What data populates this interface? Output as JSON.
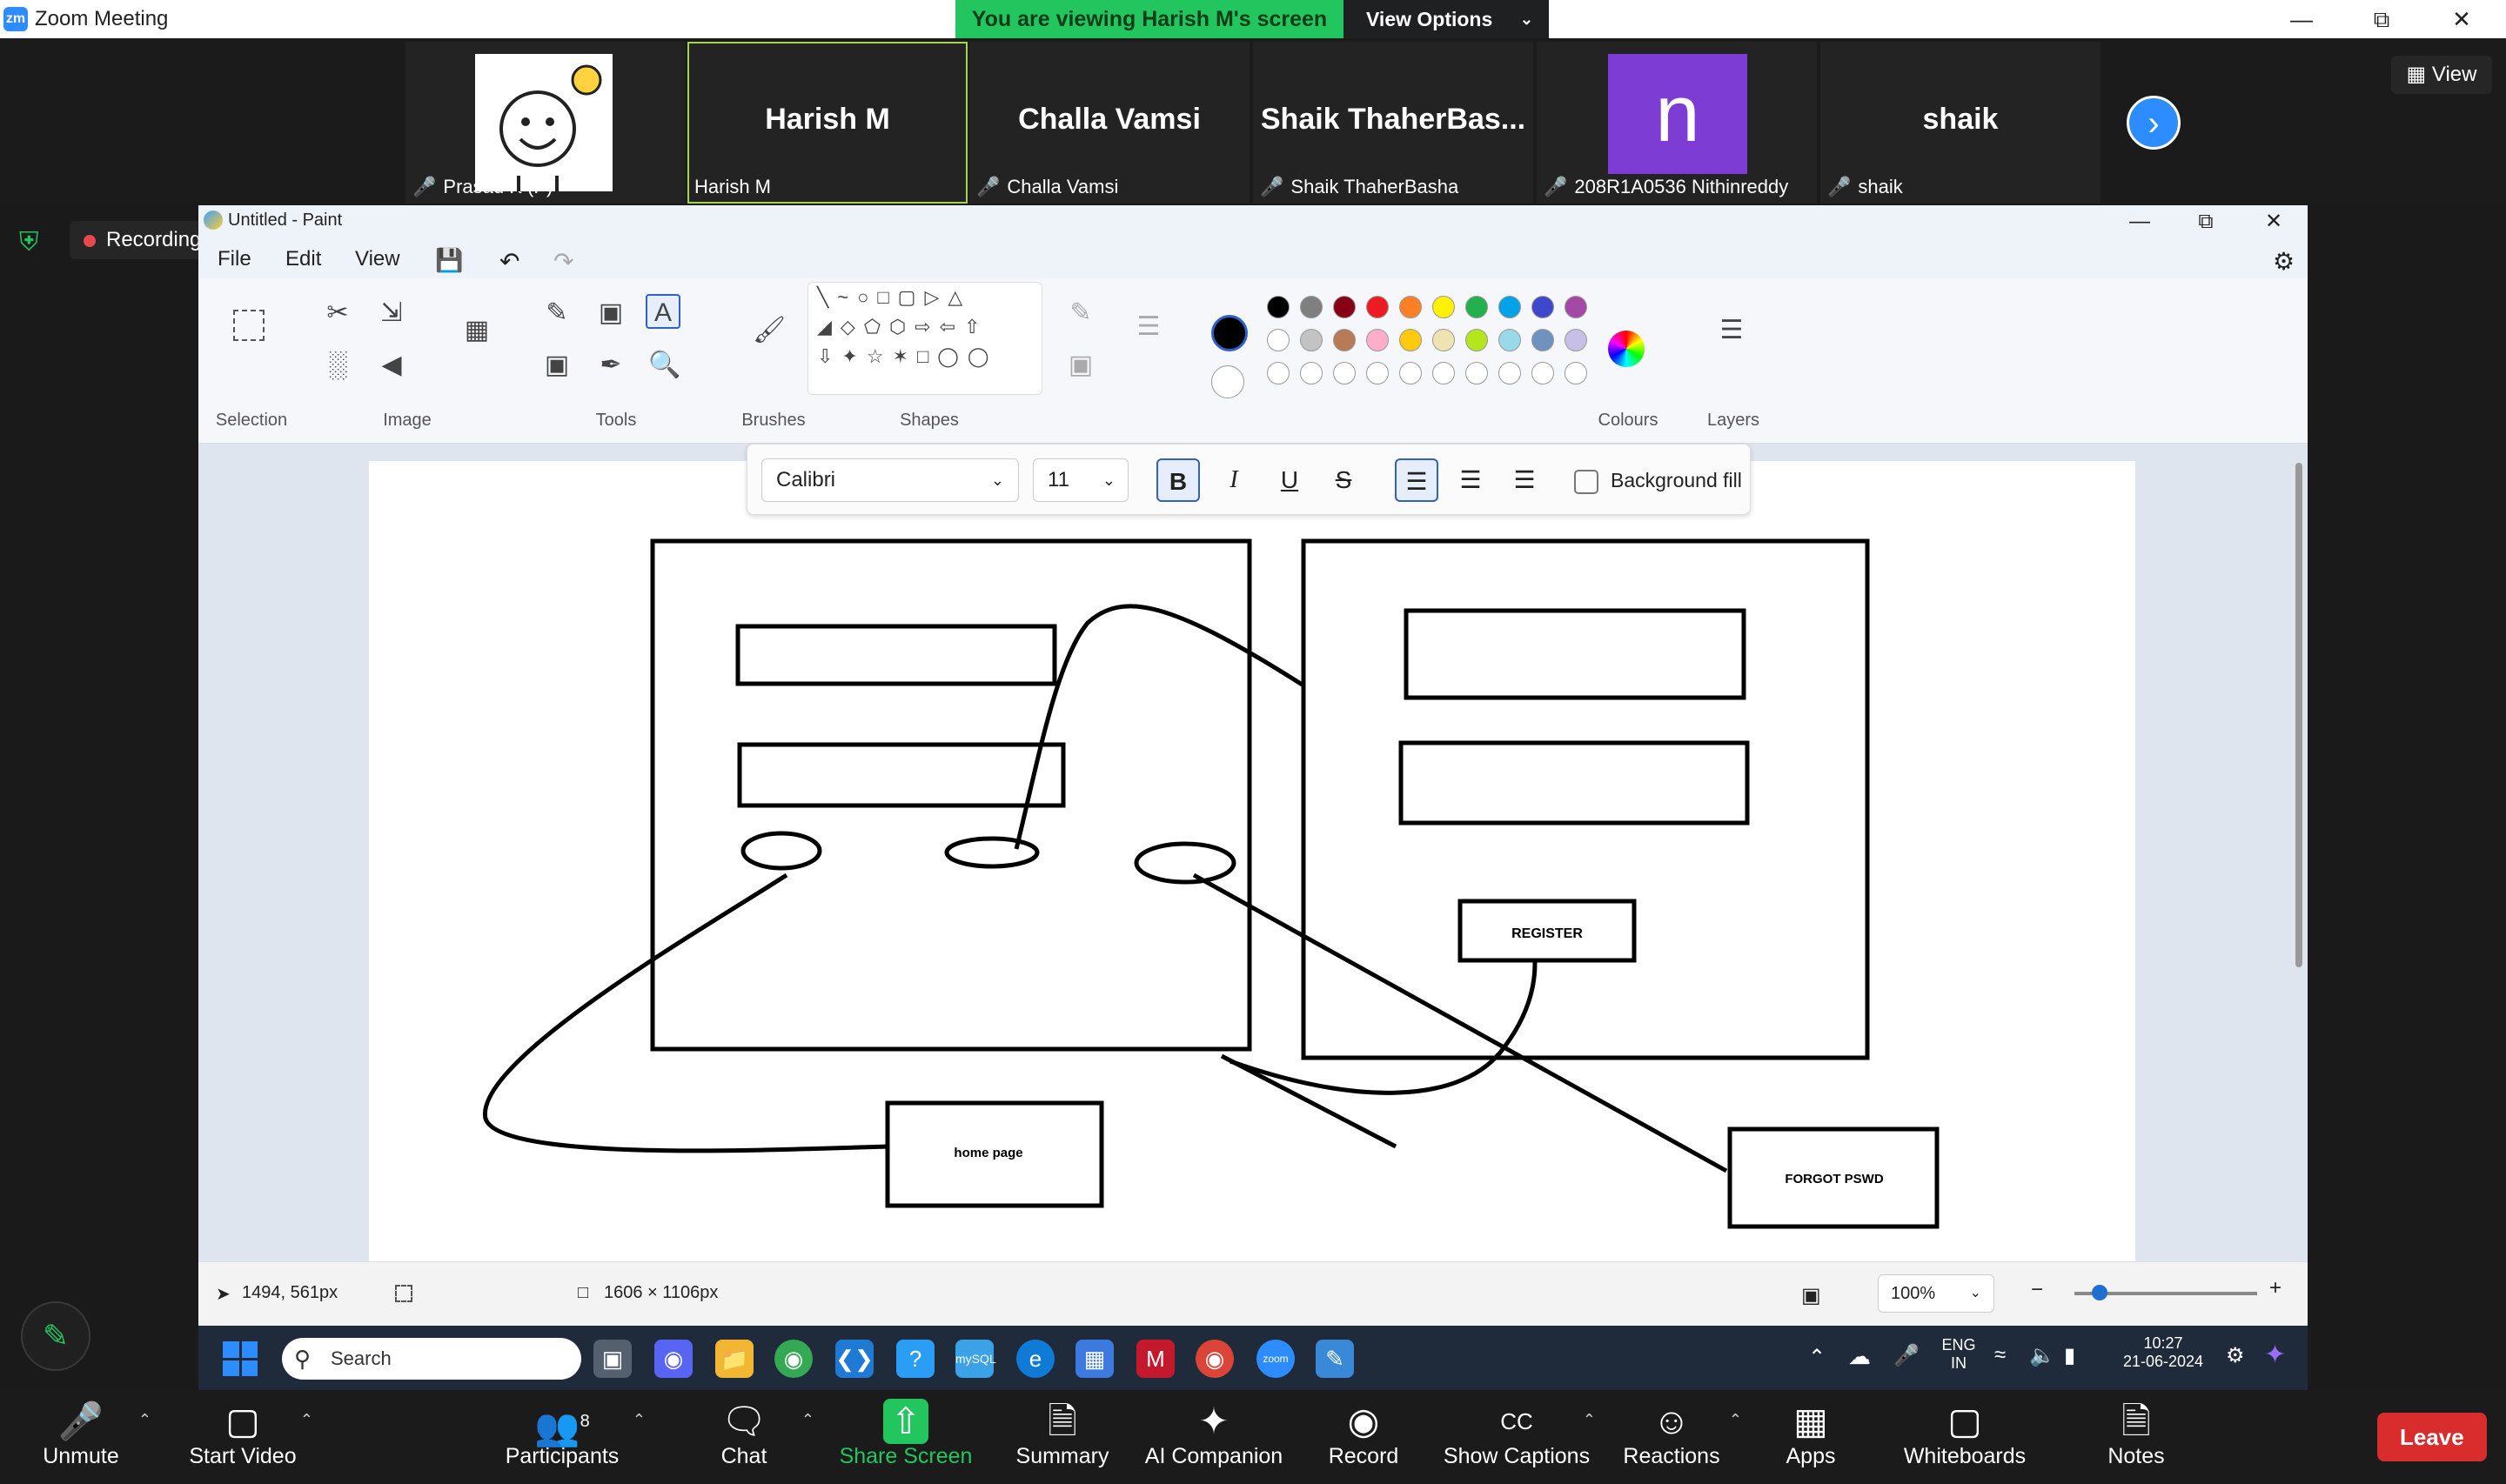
{
  "zoom": {
    "window_title": "Zoom Meeting",
    "viewing_banner": "You are viewing Harish M's screen",
    "view_options_label": "View Options",
    "view_label": "View",
    "recording_label": "Recording",
    "participants": [
      {
        "display": "",
        "label": "Prasad K (P)"
      },
      {
        "display": "Harish M",
        "label": "Harish M"
      },
      {
        "display": "Challa Vamsi",
        "label": "Challa Vamsi"
      },
      {
        "display": "Shaik  ThaherBas...",
        "label": "Shaik ThaherBasha"
      },
      {
        "display": "n",
        "label": "208R1A0536 Nithinreddy"
      },
      {
        "display": "shaik",
        "label": "shaik"
      }
    ],
    "controls": {
      "unmute": "Unmute",
      "start_video": "Start Video",
      "participants": "Participants",
      "participants_count": "8",
      "chat": "Chat",
      "share_screen": "Share Screen",
      "summary": "Summary",
      "ai_companion": "AI Companion",
      "record": "Record",
      "show_captions": "Show Captions",
      "reactions": "Reactions",
      "apps": "Apps",
      "whiteboards": "Whiteboards",
      "notes": "Notes",
      "leave": "Leave"
    }
  },
  "paint": {
    "title": "Untitled - Paint",
    "menu": [
      "File",
      "Edit",
      "View"
    ],
    "groups": {
      "selection": "Selection",
      "image": "Image",
      "tools": "Tools",
      "brushes": "Brushes",
      "shapes": "Shapes",
      "colours": "Colours",
      "layers": "Layers"
    },
    "text_toolbar": {
      "font": "Calibri",
      "size": "11",
      "background_fill": "Background fill"
    },
    "canvas_labels": {
      "register": "REGISTER",
      "home_page": "home page",
      "forgot": "FORGOT PSWD"
    },
    "status": {
      "cursor": "1494, 561px",
      "dimensions": "1606 × 1106px",
      "zoom": "100%"
    },
    "colors_row1": [
      "#000000",
      "#7f7f7f",
      "#880015",
      "#ed1c24",
      "#ff7f27",
      "#fff200",
      "#22b14c",
      "#00a2e8",
      "#3f48cc",
      "#a349a4"
    ],
    "colors_row2": [
      "#ffffff",
      "#c3c3c3",
      "#b97a57",
      "#ffaec9",
      "#ffc90e",
      "#efe4b0",
      "#b5e61d",
      "#99d9ea",
      "#7092be",
      "#c8bfe7"
    ]
  },
  "taskbar": {
    "search_placeholder": "Search",
    "lang_top": "ENG",
    "lang_bottom": "IN",
    "time": "10:27",
    "date": "21-06-2024"
  }
}
